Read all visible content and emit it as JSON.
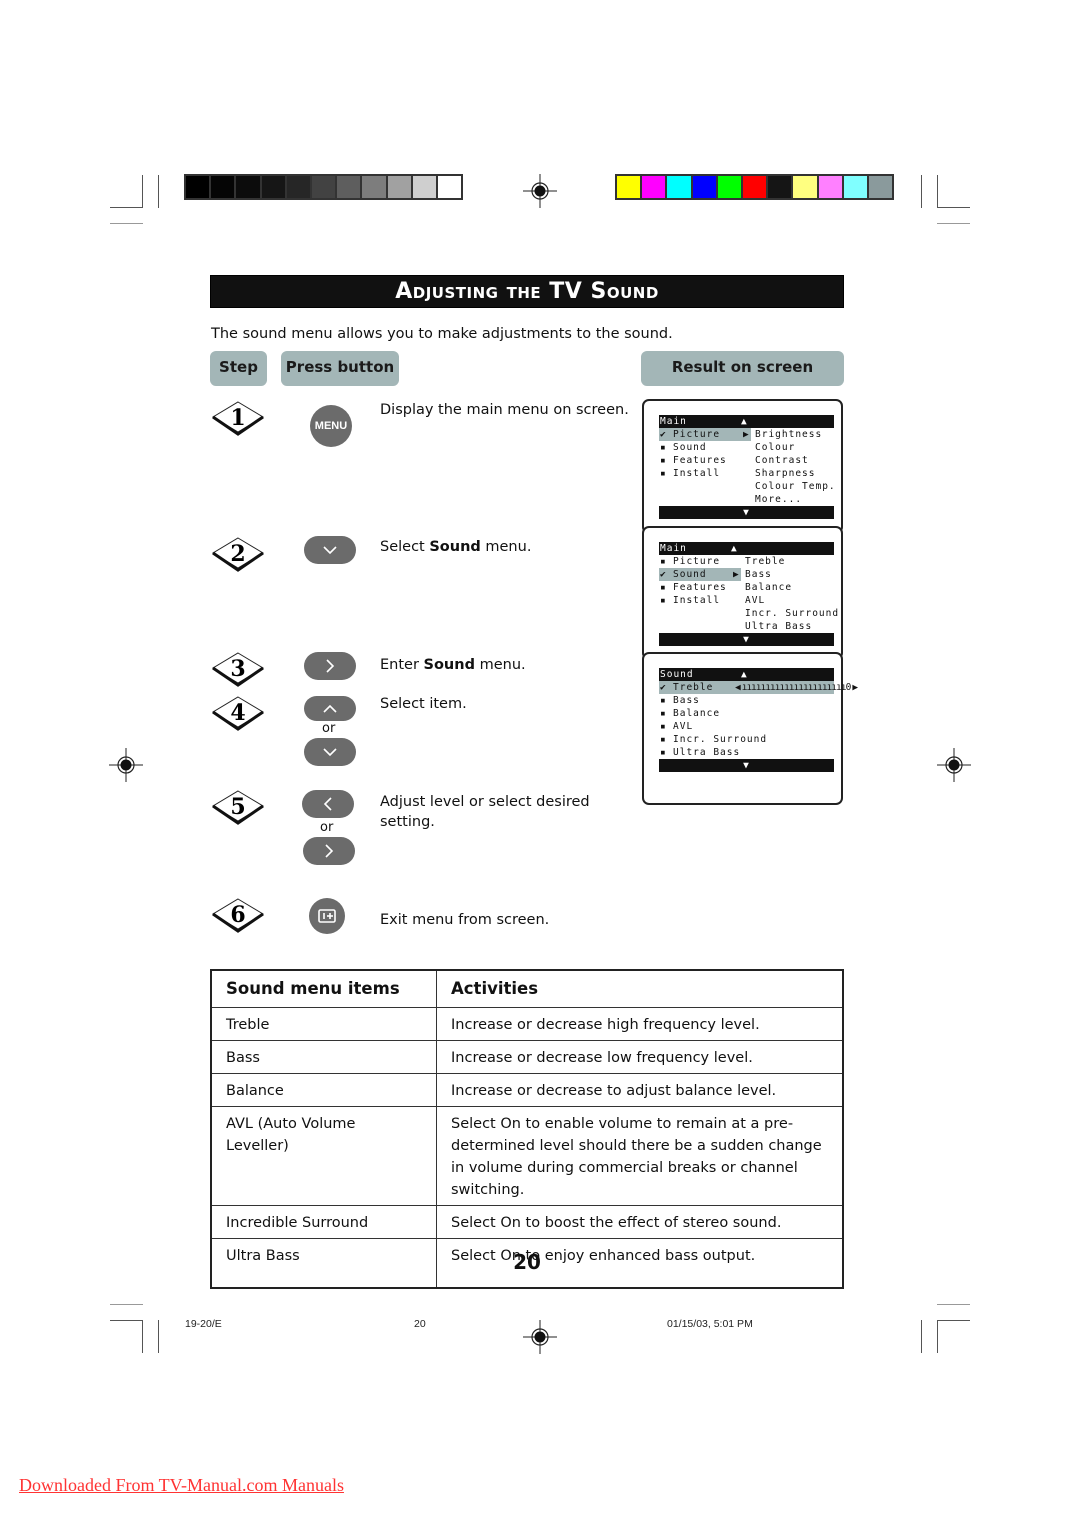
{
  "title": "Adjusting the TV Sound",
  "intro": "The sound menu allows you to make adjustments to the sound.",
  "headers": {
    "step": "Step",
    "press_button": "Press button",
    "result": "Result on screen"
  },
  "steps": [
    {
      "number": "1",
      "button": "MENU",
      "button_icon": "menu-button",
      "text": "Display the main menu on screen."
    },
    {
      "number": "2",
      "button_icon": "down-button",
      "text_pre": "Select ",
      "text_bold": "Sound",
      "text_post": " menu."
    },
    {
      "number": "3",
      "button_icon": "right-button",
      "text_pre": "Enter ",
      "text_bold": "Sound",
      "text_post": " menu."
    },
    {
      "number": "4",
      "button_icon": "up-or-down-button",
      "or": "or",
      "text": "Select item."
    },
    {
      "number": "5",
      "button_icon": "left-or-right-button",
      "or": "or",
      "text": "Adjust level or select desired setting."
    },
    {
      "number": "6",
      "button_icon": "exit-osd-button",
      "text": "Exit menu from screen."
    }
  ],
  "screens": [
    {
      "header": "Main",
      "left_items": [
        {
          "mark": "✔",
          "label": "Picture",
          "selected": true
        },
        {
          "mark": "▪",
          "label": "Sound"
        },
        {
          "mark": "▪",
          "label": "Features"
        },
        {
          "mark": "▪",
          "label": "Install"
        }
      ],
      "right_items": [
        "Brightness",
        "Colour",
        "Contrast",
        "Sharpness",
        "Colour Temp.",
        "More..."
      ]
    },
    {
      "header": "Main",
      "left_items": [
        {
          "mark": "▪",
          "label": "Picture"
        },
        {
          "mark": "✔",
          "label": "Sound",
          "selected": true
        },
        {
          "mark": "▪",
          "label": "Features"
        },
        {
          "mark": "▪",
          "label": "Install"
        }
      ],
      "right_items": [
        "Treble",
        "Bass",
        "Balance",
        "AVL",
        "Incr. Surround",
        "Ultra Bass"
      ]
    },
    {
      "header": "Sound",
      "left_items": [
        {
          "mark": "✔",
          "label": "Treble",
          "selected": true
        },
        {
          "mark": "▪",
          "label": "Bass"
        },
        {
          "mark": "▪",
          "label": "Balance"
        },
        {
          "mark": "▪",
          "label": "AVL"
        },
        {
          "mark": "▪",
          "label": "Incr. Surround"
        },
        {
          "mark": "▪",
          "label": "Ultra Bass"
        }
      ],
      "slider_value": "0"
    }
  ],
  "table": {
    "headers": [
      "Sound menu items",
      "Activities"
    ],
    "rows": [
      [
        "Treble",
        "Increase or decrease high frequency level."
      ],
      [
        "Bass",
        "Increase or decrease low frequency level."
      ],
      [
        "Balance",
        "Increase or decrease to adjust balance level."
      ],
      [
        "AVL (Auto Volume Leveller)",
        "Select On to enable volume to remain at a pre-determined level should there be a sudden change in volume during commercial breaks or channel switching."
      ],
      [
        "Incredible Surround",
        "Select On to boost the effect of stereo sound."
      ],
      [
        "Ultra Bass",
        "Select On to enjoy enhanced bass output."
      ]
    ]
  },
  "page_number": "20",
  "footer": {
    "code": "19-20/E",
    "page": "20",
    "timestamp": "01/15/03, 5:01 PM"
  },
  "download_link": "Downloaded From TV-Manual.com Manuals",
  "colors": {
    "gray_bar": [
      "#000000",
      "#050505",
      "#0c0c0c",
      "#161616",
      "#262626",
      "#424242",
      "#5e5e5e",
      "#7d7d7d",
      "#a1a1a1",
      "#cfcfcf",
      "#ffffff"
    ],
    "color_bar": [
      "#ffff00",
      "#ff00ff",
      "#00ffff",
      "#0000ff",
      "#00ff00",
      "#ff0000",
      "#151515",
      "#ffff80",
      "#ff80ff",
      "#80ffff",
      "#8a9a9c"
    ],
    "accent": "#a3b6b7",
    "button_gray": "#6b6b6b",
    "link": "#ff3333"
  }
}
